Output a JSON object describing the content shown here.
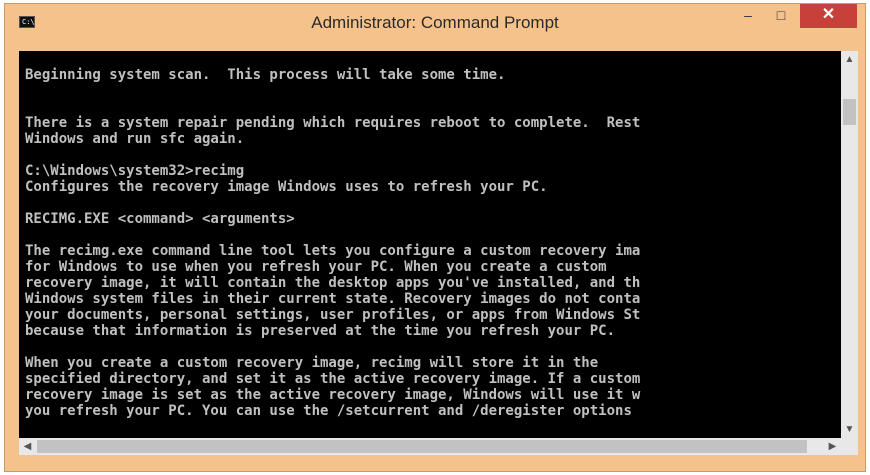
{
  "window": {
    "title": "Administrator: Command Prompt",
    "icon": "cmd-icon",
    "icon_text": "C:\\",
    "accent": "#f5c28c",
    "close_color": "#c7413a"
  },
  "controls": {
    "minimize": "–",
    "maximize": "□",
    "close": "✕"
  },
  "console": {
    "background": "#000000",
    "text_color": "#c0c0c0",
    "lines": [
      "Beginning system scan.  This process will take some time.",
      "",
      "",
      "There is a system repair pending which requires reboot to complete.  Rest",
      "Windows and run sfc again.",
      "",
      "C:\\Windows\\system32>recimg",
      "Configures the recovery image Windows uses to refresh your PC.",
      "",
      "RECIMG.EXE <command> <arguments>",
      "",
      "The recimg.exe command line tool lets you configure a custom recovery ima",
      "for Windows to use when you refresh your PC. When you create a custom",
      "recovery image, it will contain the desktop apps you've installed, and th",
      "Windows system files in their current state. Recovery images do not conta",
      "your documents, personal settings, user profiles, or apps from Windows St",
      "because that information is preserved at the time you refresh your PC.",
      "",
      "When you create a custom recovery image, recimg will store it in the",
      "specified directory, and set it as the active recovery image. If a custom",
      "recovery image is set as the active recovery image, Windows will use it w",
      "you refresh your PC. You can use the /setcurrent and /deregister options"
    ]
  },
  "scrollbars": {
    "up": "▲",
    "down": "▼",
    "left": "◀",
    "right": "▶"
  }
}
